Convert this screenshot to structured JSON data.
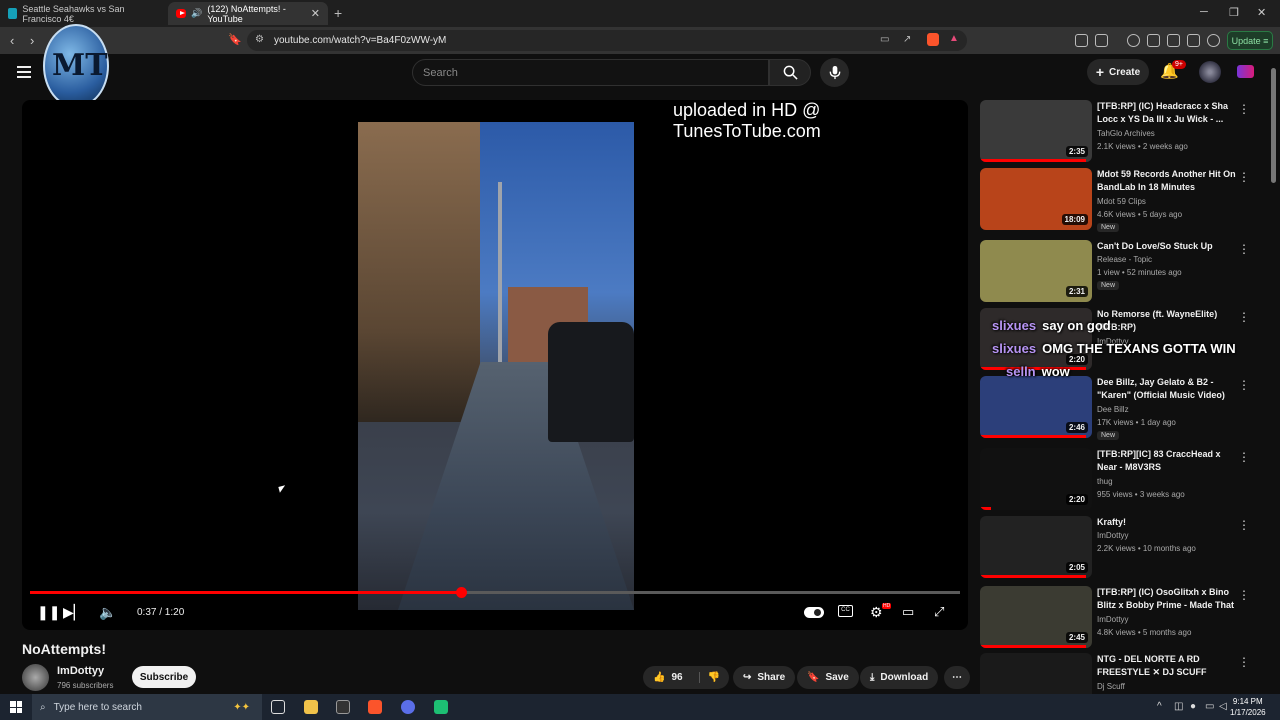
{
  "browser": {
    "tabs": [
      {
        "title": "Seattle Seahawks vs San Francisco 4€"
      },
      {
        "title": "(122) NoAttempts! - YouTube"
      }
    ],
    "url": "youtube.com/watch?v=Ba4F0zWW-yM",
    "update_label": "Update"
  },
  "header": {
    "search_placeholder": "Search",
    "create_label": "Create",
    "notification_count": "9+"
  },
  "player": {
    "overlay_text": "uploaded in HD @ TunesToTube.com",
    "time": "0:37 / 1:20",
    "progress": 0.463
  },
  "video": {
    "title": "NoAttempts!",
    "channel": "ImDottyy",
    "subscribers": "796 subscribers",
    "subscribe_label": "Subscribe",
    "likes": "96",
    "share_label": "Share",
    "save_label": "Save",
    "download_label": "Download"
  },
  "chat": [
    {
      "user": "slixues",
      "msg": "say on god"
    },
    {
      "user": "slixues",
      "msg": "OMG THE TEXANS GOTTA WIN"
    },
    {
      "user": "selln",
      "msg": "wow"
    }
  ],
  "recommendations": [
    {
      "title": "[TFB:RP] (IC) Headcracc x Sha Locc x YS Da III x Ju Wick - ...",
      "channel": "TahGlo Archives",
      "meta": "2.1K views • 2 weeks ago",
      "duration": "2:35",
      "is_new": false,
      "progress": 0.95,
      "thumb_color": "#3a3a3a"
    },
    {
      "title": "Mdot 59 Records Another Hit On BandLab In 18 Minutes",
      "channel": "Mdot 59 Clips",
      "meta": "4.6K views • 5 days ago",
      "duration": "18:09",
      "is_new": true,
      "progress": 0,
      "thumb_color": "#b8441a"
    },
    {
      "title": "Can't Do Love/So Stuck Up",
      "channel": "Release - Topic",
      "meta": "1 view • 52 minutes ago",
      "duration": "2:31",
      "is_new": true,
      "progress": 0,
      "thumb_color": "#8f8a4e"
    },
    {
      "title": "No Remorse (ft. WayneElite) (TFB:RP)",
      "channel": "ImDottyy",
      "meta": "",
      "duration": "2:20",
      "is_new": false,
      "progress": 0.95,
      "thumb_color": "#2e2a2a"
    },
    {
      "title": "Dee Billz, Jay Gelato & B2 - \"Karen\" (Official Music Video)",
      "channel": "Dee Billz",
      "meta": "17K views • 1 day ago",
      "duration": "2:46",
      "is_new": true,
      "progress": 0.95,
      "thumb_color": "#2c3f7a"
    },
    {
      "title": "[TFB:RP][IC] 83 CraccHead x Near - M8V3RS",
      "channel": "thug",
      "meta": "955 views • 3 weeks ago",
      "duration": "2:20",
      "is_new": false,
      "progress": 0.1,
      "thumb_color": "#111111"
    },
    {
      "title": "Krafty!",
      "channel": "ImDottyy",
      "meta": "2.2K views • 10 months ago",
      "duration": "2:05",
      "is_new": false,
      "progress": 0.95,
      "thumb_color": "#222222"
    },
    {
      "title": "[TFB:RP] (IC) OsoGlitxh x Bino Blitz x Bobby Prime - Made That",
      "channel": "ImDottyy",
      "meta": "4.8K views • 5 months ago",
      "duration": "2:45",
      "is_new": false,
      "progress": 0.95,
      "thumb_color": "#3b3b32"
    },
    {
      "title": "NTG - DEL NORTE A RD FREESTYLE ✕ DJ SCUFF",
      "channel": "Dj Scuff",
      "meta": "",
      "duration": "",
      "is_new": false,
      "progress": 0,
      "thumb_color": "#1a1a1a"
    }
  ],
  "taskbar": {
    "search_placeholder": "Type here to search",
    "time": "9:14 PM",
    "date": "1/17/2026"
  }
}
